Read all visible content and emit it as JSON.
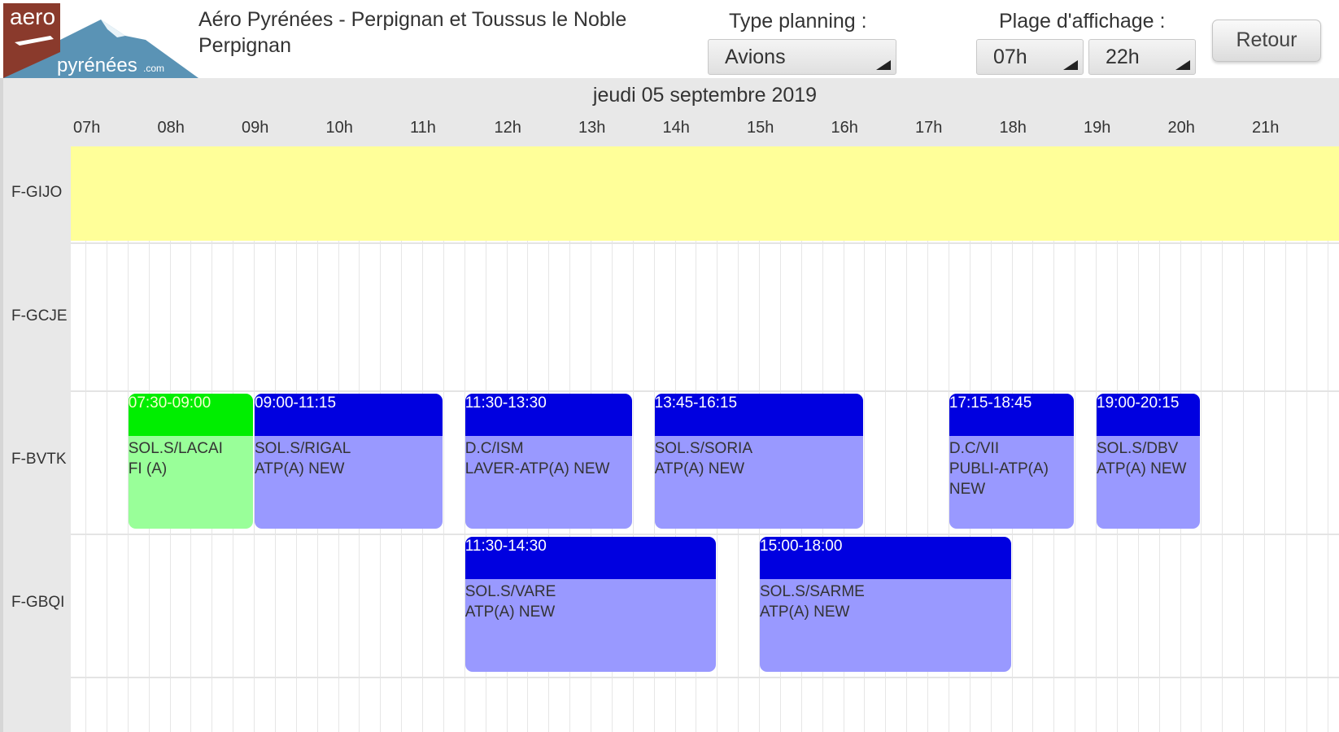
{
  "header": {
    "logo_text_top": "aero",
    "logo_text_bottom": "pyrénées.com",
    "club_line1": "Aéro Pyrénées - Perpignan et Toussus le Noble",
    "club_line2": "Perpignan",
    "type_label": "Type planning :",
    "type_value": "Avions",
    "range_label": "Plage d'affichage :",
    "range_start": "07h",
    "range_end": "22h",
    "back_button": "Retour"
  },
  "planning": {
    "date": "jeudi 05 septembre 2019",
    "hours": [
      "07h",
      "08h",
      "09h",
      "10h",
      "11h",
      "12h",
      "13h",
      "14h",
      "15h",
      "16h",
      "17h",
      "18h",
      "19h",
      "20h",
      "21h"
    ],
    "unavailable_color": "#ffff99",
    "booking_header_color": "#0000e0",
    "booking_body_color": "#9999ff",
    "aircraft": [
      {
        "reg": "F-GIJO",
        "unavailable": true,
        "bookings": []
      },
      {
        "reg": "F-GCJE",
        "unavailable": false,
        "bookings": []
      },
      {
        "reg": "F-BVTK",
        "unavailable": false,
        "bookings": [
          {
            "time": "07:30-09:00",
            "start": 7.5,
            "end": 9.0,
            "text": "SOL.S/LACAI\nFI (A)",
            "style": "green"
          },
          {
            "time": "09:00-11:15",
            "start": 9.0,
            "end": 11.25,
            "text": "SOL.S/RIGAL\nATP(A) NEW",
            "style": "blue"
          },
          {
            "time": "11:30-13:30",
            "start": 11.5,
            "end": 13.5,
            "text": "D.C/ISM\nLAVER-ATP(A) NEW",
            "style": "blue"
          },
          {
            "time": "13:45-16:15",
            "start": 13.75,
            "end": 16.25,
            "text": "SOL.S/SORIA\nATP(A) NEW",
            "style": "blue"
          },
          {
            "time": "17:15-18:45",
            "start": 17.25,
            "end": 18.75,
            "text": "D.C/VII\nPUBLI-ATP(A)\nNEW",
            "style": "blue"
          },
          {
            "time": "19:00-20:15",
            "start": 19.0,
            "end": 20.25,
            "text": "SOL.S/DBV\nATP(A) NEW",
            "style": "blue"
          }
        ]
      },
      {
        "reg": "F-GBQI",
        "unavailable": false,
        "bookings": [
          {
            "time": "11:30-14:30",
            "start": 11.5,
            "end": 14.5,
            "text": "SOL.S/VARE\nATP(A) NEW",
            "style": "blue"
          },
          {
            "time": "15:00-18:00",
            "start": 15.0,
            "end": 18.0,
            "text": "SOL.S/SARME\nATP(A) NEW",
            "style": "blue"
          }
        ]
      }
    ]
  }
}
